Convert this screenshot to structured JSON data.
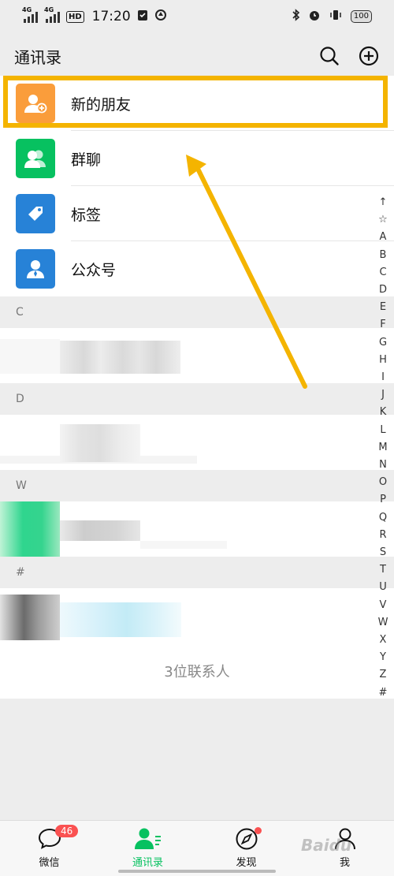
{
  "status_bar": {
    "time": "17:20",
    "net1": "4G",
    "net2": "4G",
    "hd": "HD",
    "battery": "100"
  },
  "header": {
    "title": "通讯录"
  },
  "menu": [
    {
      "label": "新的朋友",
      "color": "#fa9d3b",
      "icon": "add-friend-icon"
    },
    {
      "label": "群聊",
      "color": "#07c160",
      "icon": "group-icon"
    },
    {
      "label": "标签",
      "color": "#2782d7",
      "icon": "tag-icon"
    },
    {
      "label": "公众号",
      "color": "#2782d7",
      "icon": "official-account-icon"
    }
  ],
  "sections": [
    "C",
    "D",
    "W",
    "#"
  ],
  "contact_count": "3位联系人",
  "index_letters": [
    "↑",
    "☆",
    "A",
    "B",
    "C",
    "D",
    "E",
    "F",
    "G",
    "H",
    "I",
    "J",
    "K",
    "L",
    "M",
    "N",
    "O",
    "P",
    "Q",
    "R",
    "S",
    "T",
    "U",
    "V",
    "W",
    "X",
    "Y",
    "Z",
    "#"
  ],
  "tabs": [
    {
      "label": "微信",
      "badge": "46"
    },
    {
      "label": "通讯录"
    },
    {
      "label": "发现"
    },
    {
      "label": "我"
    }
  ],
  "watermark": "Baidu",
  "colors": {
    "accent": "#07c160",
    "highlight": "#f4b400",
    "badge": "#fa5151"
  }
}
